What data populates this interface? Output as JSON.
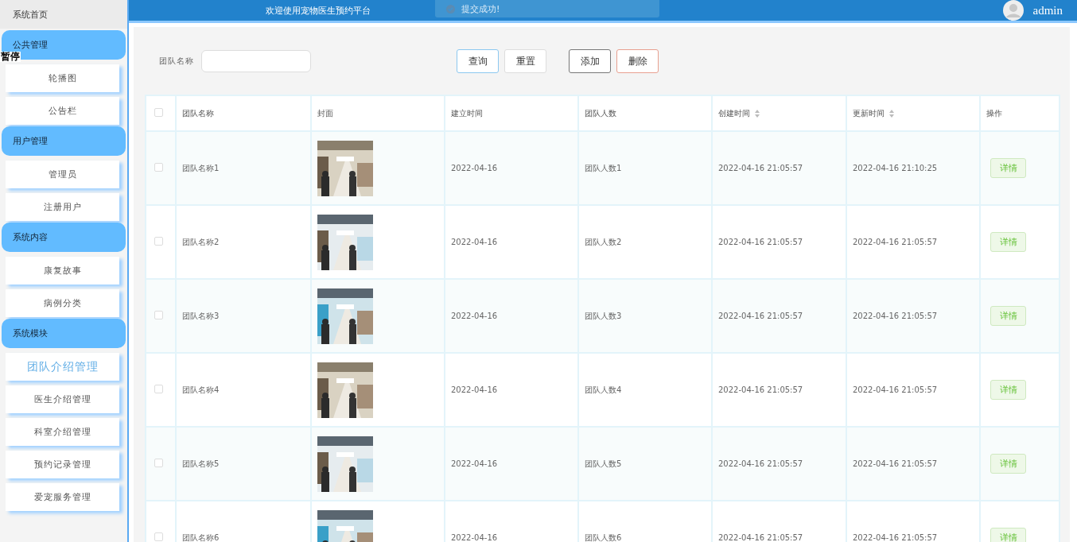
{
  "sidebar": {
    "home": "系统首页",
    "overlay_label": "暂停",
    "groups": [
      {
        "title": "公共管理",
        "items": [
          {
            "label": "轮播图",
            "selected": false
          },
          {
            "label": "公告栏",
            "selected": false
          }
        ]
      },
      {
        "title": "用户管理",
        "items": [
          {
            "label": "管理员",
            "selected": false
          },
          {
            "label": "注册用户",
            "selected": false
          }
        ]
      },
      {
        "title": "系统内容",
        "items": [
          {
            "label": "康复故事",
            "selected": false
          },
          {
            "label": "病例分类",
            "selected": false
          }
        ]
      },
      {
        "title": "系统模块",
        "items": [
          {
            "label": "团队介绍管理",
            "selected": true
          },
          {
            "label": "医生介绍管理",
            "selected": false
          },
          {
            "label": "科室介绍管理",
            "selected": false
          },
          {
            "label": "预约记录管理",
            "selected": false
          },
          {
            "label": "爱宠服务管理",
            "selected": false
          }
        ]
      }
    ]
  },
  "header": {
    "title": "欢迎使用宠物医生预约平台",
    "toast": "提交成功!",
    "user": "admin"
  },
  "search": {
    "label": "团队名称",
    "buttons": [
      {
        "label": "查询",
        "kind": "primary"
      },
      {
        "label": "重置",
        "kind": "plain"
      }
    ]
  },
  "actions": [
    {
      "label": "添加",
      "kind": "dark"
    },
    {
      "label": "删除",
      "kind": "danger"
    }
  ],
  "table": {
    "select_all": {
      "checked": false
    },
    "columns": [
      {
        "label": "团队名称",
        "sortable": false
      },
      {
        "label": "封面",
        "sortable": false
      },
      {
        "label": "建立时间",
        "sortable": false
      },
      {
        "label": "团队人数",
        "sortable": false
      },
      {
        "label": "创建时间",
        "sortable": true
      },
      {
        "label": "更新时间",
        "sortable": true
      },
      {
        "label": "操作",
        "sortable": false
      }
    ],
    "rows": [
      {
        "checked": false,
        "name": "团队名称1",
        "founded": "2022-04-16",
        "members": "团队人数1",
        "created": "2022-04-16 21:05:57",
        "updated": "2022-04-16 21:10:25",
        "action": "详情"
      },
      {
        "checked": false,
        "name": "团队名称2",
        "founded": "2022-04-16",
        "members": "团队人数2",
        "created": "2022-04-16 21:05:57",
        "updated": "2022-04-16 21:05:57",
        "action": "详情"
      },
      {
        "checked": false,
        "name": "团队名称3",
        "founded": "2022-04-16",
        "members": "团队人数3",
        "created": "2022-04-16 21:05:57",
        "updated": "2022-04-16 21:05:57",
        "action": "详情"
      },
      {
        "checked": false,
        "name": "团队名称4",
        "founded": "2022-04-16",
        "members": "团队人数4",
        "created": "2022-04-16 21:05:57",
        "updated": "2022-04-16 21:05:57",
        "action": "详情"
      },
      {
        "checked": false,
        "name": "团队名称5",
        "founded": "2022-04-16",
        "members": "团队人数5",
        "created": "2022-04-16 21:05:57",
        "updated": "2022-04-16 21:05:57",
        "action": "详情"
      },
      {
        "checked": false,
        "name": "团队名称6",
        "founded": "2022-04-16",
        "members": "团队人数6",
        "created": "2022-04-16 21:05:57",
        "updated": "2022-04-16 21:05:57",
        "action": "详情"
      }
    ]
  }
}
